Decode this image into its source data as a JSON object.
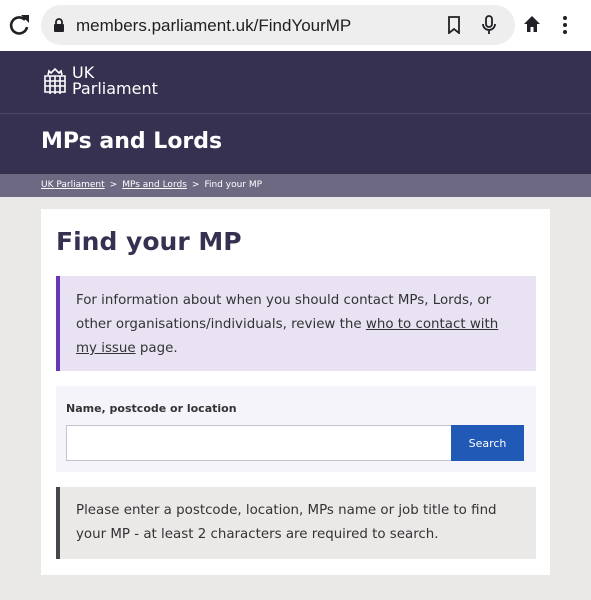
{
  "browser": {
    "url": "members.parliament.uk/FindYourMP",
    "icons": [
      "reload-icon",
      "lock-icon",
      "bookmark-icon",
      "microphone-icon",
      "home-icon",
      "more-menu-icon"
    ]
  },
  "brand": {
    "line1": "UK",
    "line2": "Parliament"
  },
  "section": {
    "title": "MPs and Lords"
  },
  "breadcrumb": {
    "items": [
      "UK Parliament",
      "MPs and Lords",
      "Find your MP"
    ],
    "separator": ">"
  },
  "main": {
    "title": "Find your MP",
    "info": {
      "text_before": "For information about when you should contact MPs, Lords, or other organisations/individuals, review the ",
      "link": "who to contact with my issue",
      "text_after": " page."
    },
    "search": {
      "label": "Name, postcode or location",
      "value": "",
      "placeholder": "",
      "button": "Search"
    },
    "hint": "Please enter a postcode, location, MPs name or job title to find your MP - at least 2 characters are required to search."
  },
  "colors": {
    "header_bg": "#373151",
    "breadcrumb_bg": "#6e6983",
    "info_bg": "#e8e2f3",
    "info_accent": "#6a36b8",
    "button_bg": "#2159b6",
    "page_bg": "#ebe9e8"
  }
}
